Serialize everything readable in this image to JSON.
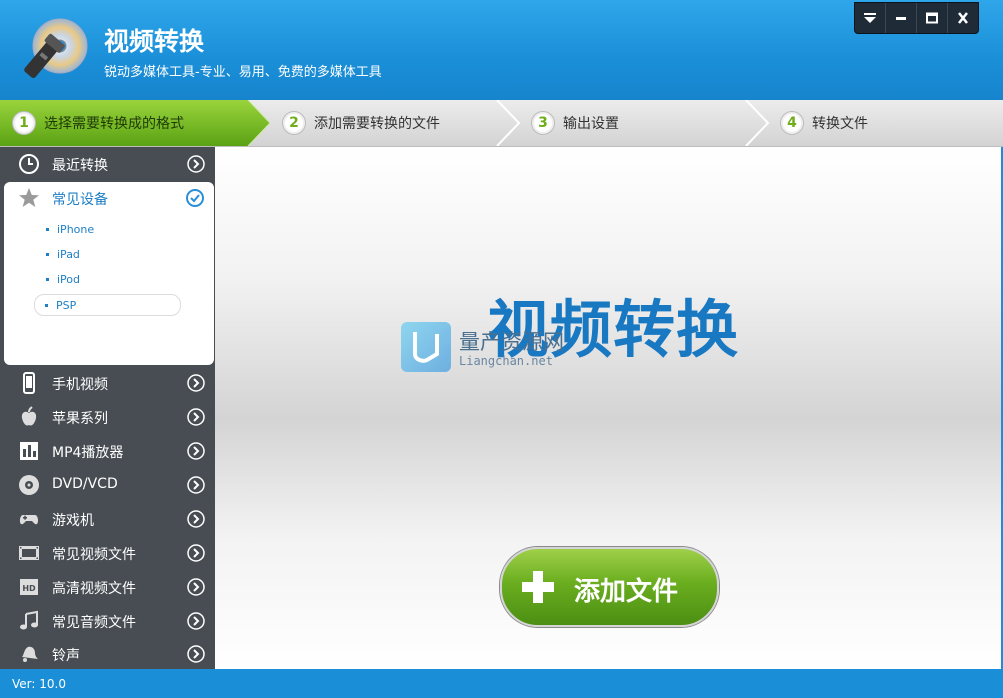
{
  "app": {
    "title": "视频转换",
    "subtitle": "锐动多媒体工具-专业、易用、免费的多媒体工具"
  },
  "window_controls": [
    "menu-icon",
    "minimize-icon",
    "maximize-icon",
    "close-icon"
  ],
  "steps": [
    {
      "num": "1",
      "label": "选择需要转换成的格式",
      "active": true
    },
    {
      "num": "2",
      "label": "添加需要转换的文件",
      "active": false
    },
    {
      "num": "3",
      "label": "输出设置",
      "active": false
    },
    {
      "num": "4",
      "label": "转换文件",
      "active": false
    }
  ],
  "sidebar": {
    "recent": {
      "label": "最近转换",
      "icon": "clock-icon"
    },
    "common_devices": {
      "label": "常见设备",
      "icon": "star-icon",
      "expanded": true,
      "items": [
        "iPhone",
        "iPad",
        "iPod",
        "PSP"
      ],
      "selected": "PSP"
    },
    "items": [
      {
        "label": "手机视频",
        "icon": "phone-icon"
      },
      {
        "label": "苹果系列",
        "icon": "apple-icon"
      },
      {
        "label": "MP4播放器",
        "icon": "mp4-player-icon"
      },
      {
        "label": "DVD/VCD",
        "icon": "disc-icon"
      },
      {
        "label": "游戏机",
        "icon": "gamepad-icon"
      },
      {
        "label": "常见视频文件",
        "icon": "film-icon"
      },
      {
        "label": "高清视频文件",
        "icon": "hd-icon"
      },
      {
        "label": "常见音频文件",
        "icon": "music-icon"
      },
      {
        "label": "铃声",
        "icon": "bell-icon"
      }
    ]
  },
  "main": {
    "title": "视频转换",
    "watermark": {
      "text": "量产资源网",
      "sub": "Liangchan.net"
    },
    "add_button": "添加文件"
  },
  "status": {
    "version": "Ver: 10.0"
  },
  "colors": {
    "accent": "#1a8fd8",
    "green": "#6aad1f",
    "sidebar": "#474d52",
    "link": "#1e7fc6"
  }
}
